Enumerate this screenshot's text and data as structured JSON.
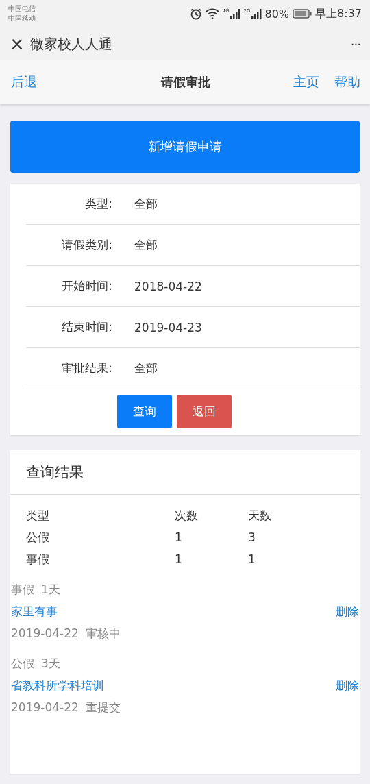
{
  "status_bar": {
    "carriers": [
      "中国电信",
      "中国移动"
    ],
    "signal_labels": [
      "4G",
      "2G"
    ],
    "battery": "80%",
    "time": "早上8:37"
  },
  "title_bar": {
    "close": "×",
    "title": "微家校人人通",
    "more": "···"
  },
  "nav": {
    "back": "后退",
    "title": "请假审批",
    "links": [
      "主页",
      "帮助"
    ]
  },
  "new_button": "新增请假申请",
  "filters": [
    {
      "label": "类型:",
      "value": "全部"
    },
    {
      "label": "请假类别:",
      "value": "全部"
    },
    {
      "label": "开始时间:",
      "value": "2018-04-22"
    },
    {
      "label": "结束时间:",
      "value": "2019-04-23"
    },
    {
      "label": "审批结果:",
      "value": "全部"
    }
  ],
  "filter_buttons": [
    {
      "label": "查询",
      "kind": "primary"
    },
    {
      "label": "返回",
      "kind": "danger"
    }
  ],
  "results": {
    "title": "查询结果",
    "columns": [
      "类型",
      "次数",
      "天数"
    ],
    "rows": [
      [
        "公假",
        "1",
        "3"
      ],
      [
        "事假",
        "1",
        "1"
      ]
    ],
    "entries": [
      {
        "type": "事假",
        "days": "1天",
        "title": "家里有事",
        "action": "删除",
        "date": "2019-04-22",
        "status": "审核中"
      },
      {
        "type": "公假",
        "days": "3天",
        "title": "省教科所学科培训",
        "action": "删除",
        "date": "2019-04-22",
        "status": "重提交"
      }
    ]
  }
}
